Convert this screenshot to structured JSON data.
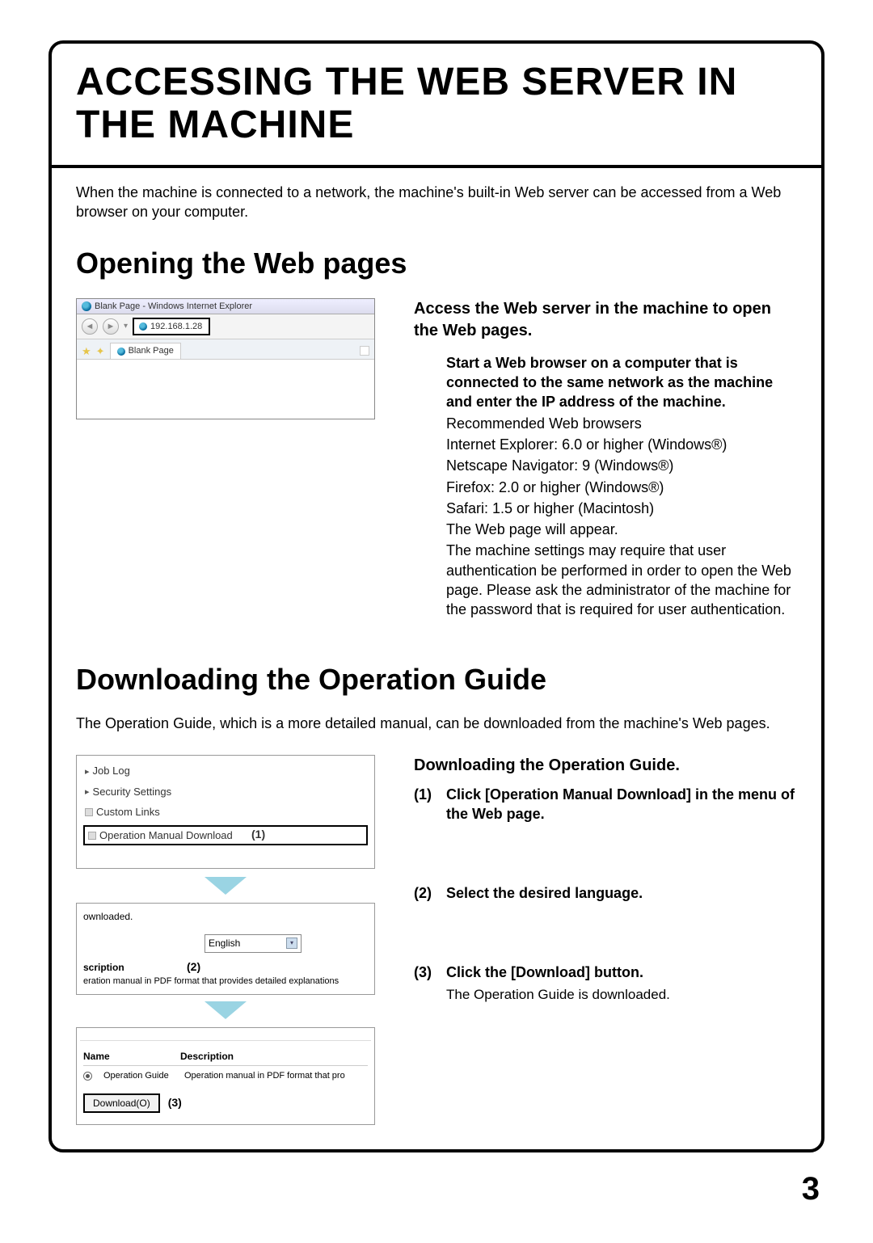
{
  "page_number": "3",
  "title": "ACCESSING THE WEB SERVER IN THE MACHINE",
  "intro": "When the machine is connected to a network, the machine's built-in Web server can be accessed from a Web browser on your computer.",
  "section1_heading": "Opening the Web pages",
  "browser": {
    "window_title": "Blank Page - Windows Internet Explorer",
    "address": "192.168.1.28",
    "tab_label": "Blank Page"
  },
  "access": {
    "heading": "Access the Web server in the machine to open the Web pages.",
    "bold_para": "Start a Web browser on a computer that is connected to the same network as the machine and enter the IP address of the machine.",
    "rec_label": "Recommended Web browsers",
    "ie": "Internet Explorer: 6.0 or higher (Windows®)",
    "netscape": "Netscape Navigator: 9 (Windows®)",
    "firefox": "Firefox: 2.0 or higher (Windows®)",
    "safari": "Safari: 1.5 or higher (Macintosh)",
    "appear": "The Web page will appear.",
    "auth": "The machine settings may require that user authentication be performed in order to open the Web page. Please ask the administrator of the machine for the password that is required for user authentication."
  },
  "section2_heading": "Downloading the Operation Guide",
  "section2_intro": "The Operation Guide, which is a more detailed manual, can be downloaded from the machine's Web pages.",
  "menu": {
    "job_log": "Job Log",
    "security": "Security Settings",
    "custom": "Custom Links",
    "download": "Operation Manual Download",
    "callout1": "(1)"
  },
  "lang": {
    "top": "ownloaded.",
    "value": "English",
    "desc_head": "scription",
    "callout2": "(2)",
    "desc_body": "eration manual in PDF format that provides detailed explanations"
  },
  "dl": {
    "col_name": "Name",
    "col_desc": "Description",
    "row_name": "Operation Guide",
    "row_desc": "Operation manual in PDF format that pro",
    "button": "Download(O)",
    "callout3": "(3)"
  },
  "steps": {
    "heading": "Downloading the Operation Guide.",
    "s1_num": "(1)",
    "s1_text": "Click [Operation Manual Download] in the menu of the Web page.",
    "s2_num": "(2)",
    "s2_text": "Select the desired language.",
    "s3_num": "(3)",
    "s3_text": "Click the [Download] button.",
    "s3_sub": "The Operation Guide is downloaded."
  }
}
